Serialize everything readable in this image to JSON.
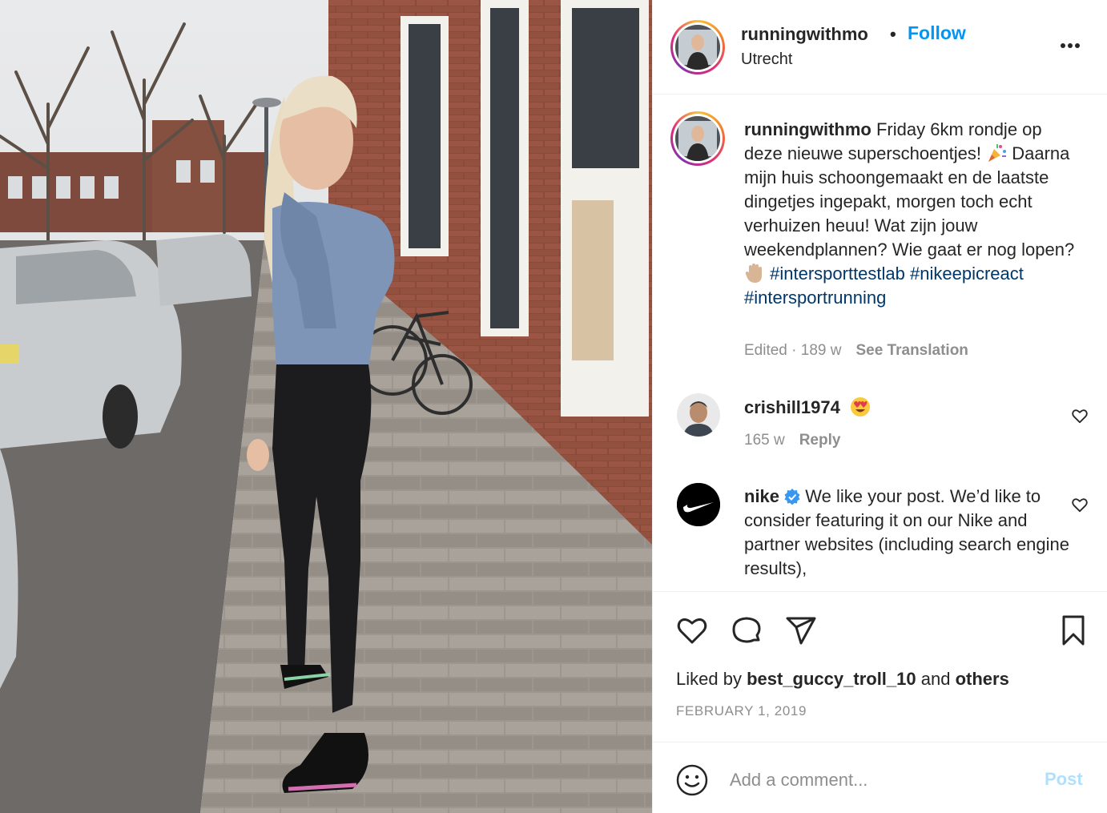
{
  "header": {
    "username": "runningwithmo",
    "separator": "•",
    "follow_label": "Follow",
    "location": "Utrecht"
  },
  "caption": {
    "username": "runningwithmo",
    "part1": "Friday 6km rondje op deze nieuwe superschoentjes!",
    "part2": "Daarna mijn huis schoongemaakt en de laatste dingetjes ingepakt, morgen toch echt verhuizen heuu! Wat zijn jouw weekendplannen? Wie gaat er nog lopen?",
    "hashtags": [
      "#intersporttestlab",
      "#nikeepicreact",
      "#intersportrunning"
    ],
    "meta_time": "Edited · 189 w",
    "translate_label": "See Translation"
  },
  "comments": [
    {
      "username": "crishill1974",
      "time": "165 w",
      "reply_label": "Reply"
    },
    {
      "username": "nike",
      "text": "We like your post. We’d like to consider featuring it on our Nike and partner websites (including search engine results),",
      "verified": true
    }
  ],
  "actions": {
    "liked_prefix": "Liked by",
    "liked_user": "best_guccy_troll_10",
    "liked_and": "and",
    "liked_others": "others",
    "date": "FEBRUARY 1, 2019"
  },
  "add_comment": {
    "placeholder": "Add a comment...",
    "post_label": "Post"
  },
  "colors": {
    "link_blue": "#0095f6",
    "hashtag_blue": "#00376b",
    "muted_gray": "#8e8e8e",
    "post_disabled": "#b2dffc",
    "text": "#262626"
  },
  "icons": [
    "more-icon",
    "heart-icon",
    "comment-icon",
    "share-icon",
    "save-icon",
    "emoji-icon",
    "verified-badge-icon",
    "party-popper-icon",
    "raised-hand-icon",
    "heart-eyes-icon"
  ]
}
